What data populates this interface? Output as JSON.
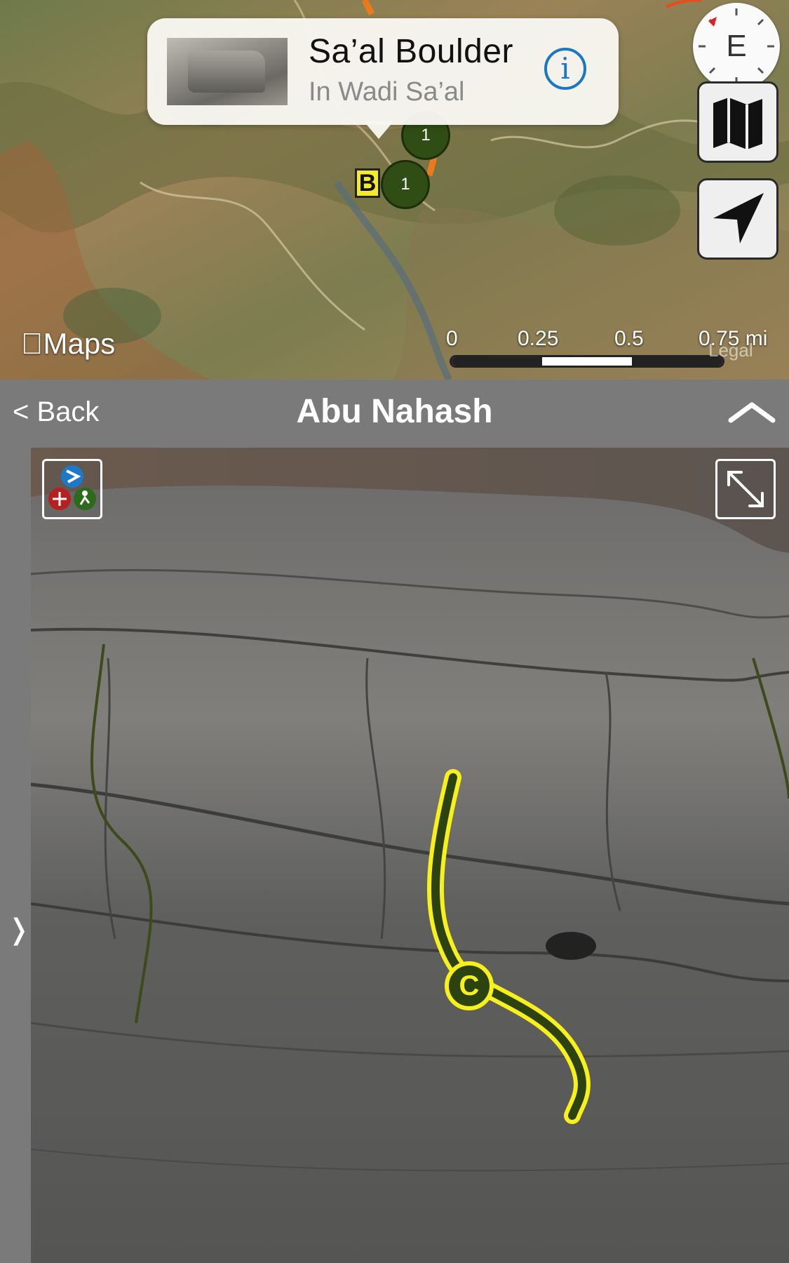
{
  "map": {
    "callout": {
      "title": "Sa’al Boulder",
      "subtitle": "In Wadi Sa’al",
      "info_icon": "info-circle-icon"
    },
    "compass": {
      "heading_letter": "E"
    },
    "attribution": "Maps",
    "scale": {
      "labels": [
        "0",
        "0.25",
        "0.5",
        "0.75 mi"
      ],
      "legal": "Legal"
    },
    "markers": {
      "b_label": "B",
      "cluster_count": "1"
    }
  },
  "navbar": {
    "back_label": "< Back",
    "title": "Abu Nahash"
  },
  "topo": {
    "route_marker": "C"
  },
  "colors": {
    "route_yellow": "#f7f01a",
    "route_dark": "#2c4210",
    "info_blue": "#1a78c2",
    "marker_yellow": "#f4ea27"
  }
}
